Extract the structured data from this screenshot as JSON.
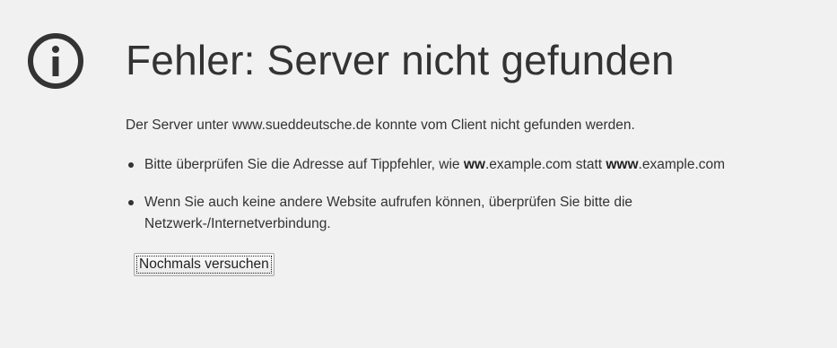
{
  "icon": "info-circle-icon",
  "title": "Fehler: Server nicht gefunden",
  "description": "Der Server unter www.sueddeutsche.de konnte vom Client nicht gefunden werden.",
  "hints": [
    {
      "before": "Bitte überprüfen Sie die Adresse auf Tippfehler, wie ",
      "bold1": "ww",
      "middle": ".example.com statt ",
      "bold2": "www",
      "after": ".example.com"
    },
    {
      "text": "Wenn Sie auch keine andere Website aufrufen können, überprüfen Sie bitte die Netzwerk-/Internetverbindung."
    }
  ],
  "retry_button": "Nochmals versuchen",
  "colors": {
    "background": "#f1f1f1",
    "text": "#333333"
  }
}
